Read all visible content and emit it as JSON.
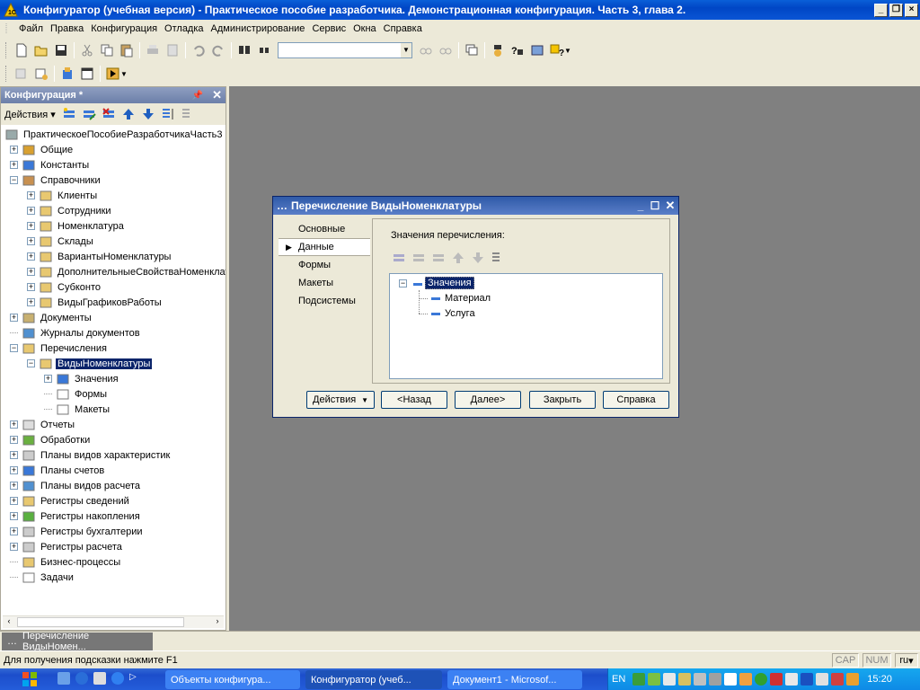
{
  "window": {
    "title": "Конфигуратор (учебная версия) - Практическое пособие разработчика. Демонстрационная конфигурация. Часть 3, глава 2."
  },
  "menu": {
    "items": [
      {
        "label": "Файл",
        "key": "Ф"
      },
      {
        "label": "Правка"
      },
      {
        "label": "Конфигурация"
      },
      {
        "label": "Отладка"
      },
      {
        "label": "Администрирование"
      },
      {
        "label": "Сервис"
      },
      {
        "label": "Окна"
      },
      {
        "label": "Справка"
      }
    ]
  },
  "left_panel": {
    "title": "Конфигурация *",
    "actions_label": "Действия",
    "tree": [
      {
        "label": "ПрактическоеПособиеРазработчикаЧасть3",
        "level": 0,
        "icon": "config-icon",
        "toggle": ""
      },
      {
        "label": "Общие",
        "level": 1,
        "icon": "common-icon",
        "toggle": "+"
      },
      {
        "label": "Константы",
        "level": 1,
        "icon": "constants-icon",
        "toggle": "+"
      },
      {
        "label": "Справочники",
        "level": 1,
        "icon": "catalogs-icon",
        "toggle": "−"
      },
      {
        "label": "Клиенты",
        "level": 2,
        "icon": "folder-icon",
        "toggle": "+"
      },
      {
        "label": "Сотрудники",
        "level": 2,
        "icon": "folder-icon",
        "toggle": "+"
      },
      {
        "label": "Номенклатура",
        "level": 2,
        "icon": "folder-icon",
        "toggle": "+"
      },
      {
        "label": "Склады",
        "level": 2,
        "icon": "folder-icon",
        "toggle": "+"
      },
      {
        "label": "ВариантыНоменклатуры",
        "level": 2,
        "icon": "folder-icon",
        "toggle": "+"
      },
      {
        "label": "ДополнительныеСвойстваНоменклатуры",
        "level": 2,
        "icon": "folder-icon",
        "toggle": "+"
      },
      {
        "label": "Субконто",
        "level": 2,
        "icon": "folder-icon",
        "toggle": "+"
      },
      {
        "label": "ВидыГрафиковРаботы",
        "level": 2,
        "icon": "folder-icon",
        "toggle": "+"
      },
      {
        "label": "Документы",
        "level": 1,
        "icon": "documents-icon",
        "toggle": "+"
      },
      {
        "label": "Журналы документов",
        "level": 1,
        "icon": "journals-icon",
        "toggle": ""
      },
      {
        "label": "Перечисления",
        "level": 1,
        "icon": "enums-icon",
        "toggle": "−"
      },
      {
        "label": "ВидыНоменклатуры",
        "level": 2,
        "icon": "enum-icon",
        "toggle": "−",
        "selected": true
      },
      {
        "label": "Значения",
        "level": 3,
        "icon": "values-icon",
        "toggle": "+"
      },
      {
        "label": "Формы",
        "level": 3,
        "icon": "forms-icon",
        "toggle": ""
      },
      {
        "label": "Макеты",
        "level": 3,
        "icon": "templates-icon",
        "toggle": ""
      },
      {
        "label": "Отчеты",
        "level": 1,
        "icon": "reports-icon",
        "toggle": "+"
      },
      {
        "label": "Обработки",
        "level": 1,
        "icon": "processing-icon",
        "toggle": "+"
      },
      {
        "label": "Планы видов характеристик",
        "level": 1,
        "icon": "chart-types-icon",
        "toggle": "+"
      },
      {
        "label": "Планы счетов",
        "level": 1,
        "icon": "accounts-icon",
        "toggle": "+"
      },
      {
        "label": "Планы видов расчета",
        "level": 1,
        "icon": "calc-types-icon",
        "toggle": "+"
      },
      {
        "label": "Регистры сведений",
        "level": 1,
        "icon": "info-registers-icon",
        "toggle": "+"
      },
      {
        "label": "Регистры накопления",
        "level": 1,
        "icon": "accum-registers-icon",
        "toggle": "+"
      },
      {
        "label": "Регистры бухгалтерии",
        "level": 1,
        "icon": "acc-registers-icon",
        "toggle": "+"
      },
      {
        "label": "Регистры расчета",
        "level": 1,
        "icon": "calc-registers-icon",
        "toggle": "+"
      },
      {
        "label": "Бизнес-процессы",
        "level": 1,
        "icon": "bp-icon",
        "toggle": ""
      },
      {
        "label": "Задачи",
        "level": 1,
        "icon": "tasks-icon",
        "toggle": ""
      }
    ]
  },
  "dialog": {
    "title": "Перечисление ВидыНоменклатуры",
    "tabs": [
      {
        "label": "Основные",
        "active": false
      },
      {
        "label": "Данные",
        "active": true
      },
      {
        "label": "Формы",
        "active": false
      },
      {
        "label": "Макеты",
        "active": false
      },
      {
        "label": "Подсистемы",
        "active": false
      }
    ],
    "values_label": "Значения перечисления:",
    "tree_root": "Значения",
    "tree_items": [
      "Материал",
      "Услуга"
    ],
    "buttons": {
      "actions": "Действия",
      "back": "<Назад",
      "next": "Далее>",
      "close": "Закрыть",
      "help": "Справка"
    }
  },
  "mdi_tab": "Перечисление ВидыНомен...",
  "status": {
    "hint": "Для получения подсказки нажмите F1",
    "cap": "CAP",
    "num": "NUM",
    "lang": "ru"
  },
  "taskbar": {
    "tasks": [
      {
        "label": "Объекты конфигура...",
        "active": false
      },
      {
        "label": "Конфигуратор (учеб...",
        "active": true
      },
      {
        "label": "Документ1 - Microsof...",
        "active": false
      }
    ],
    "lang": "EN",
    "clock": "15:20"
  },
  "colors": {
    "titlebar": "#0A5FD8",
    "selection": "#0A246A",
    "mdi_background": "#808080",
    "dialog_title": "#2F5AA8"
  }
}
